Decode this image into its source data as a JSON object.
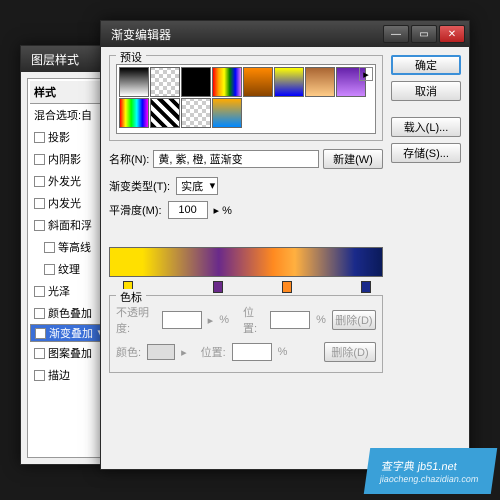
{
  "layerStyle": {
    "title": "图层样式",
    "panelHeader": "样式",
    "blendRow": "混合选项:自",
    "items": [
      {
        "label": "投影",
        "checked": false
      },
      {
        "label": "内阴影",
        "checked": false
      },
      {
        "label": "外发光",
        "checked": false
      },
      {
        "label": "内发光",
        "checked": false
      },
      {
        "label": "斜面和浮",
        "checked": false
      },
      {
        "label": "等高线",
        "checked": false,
        "indent": true
      },
      {
        "label": "纹理",
        "checked": false,
        "indent": true
      },
      {
        "label": "光泽",
        "checked": false
      },
      {
        "label": "颜色叠加",
        "checked": false
      },
      {
        "label": "渐变叠加",
        "checked": true,
        "selected": true
      },
      {
        "label": "图案叠加",
        "checked": false
      },
      {
        "label": "描边",
        "checked": false
      }
    ]
  },
  "gradEditor": {
    "title": "渐变编辑器",
    "presetsLabel": "预设",
    "arrowIcon": "▸",
    "buttons": {
      "ok": "确定",
      "cancel": "取消",
      "load": "载入(L)...",
      "save": "存储(S)...",
      "new": "新建(W)"
    },
    "nameLabel": "名称(N):",
    "nameValue": "黄, 紫, 橙, 蓝渐变",
    "typeLabel": "渐变类型(T):",
    "typeValue": "实底",
    "smoothLabel": "平滑度(M):",
    "smoothValue": "100",
    "smoothUnit": "%",
    "stopsTitle": "色标",
    "opacityLabel": "不透明度:",
    "locationLabel": "位置:",
    "colorLabel": "颜色:",
    "deleteLabel": "删除(D)",
    "percentUnit": "%",
    "swatches": [
      "linear-gradient(#000,#fff)",
      "repeating-conic-gradient(#ccc 0 25%,#fff 0 50%) 0/8px 8px",
      "linear-gradient(#000,#000)",
      "linear-gradient(90deg,red,orange,yellow,green,blue,violet)",
      "linear-gradient(#f80,#840)",
      "linear-gradient(#ff0,#00f)",
      "linear-gradient(#a63,#fc8)",
      "linear-gradient(#62a,#c8f)",
      "linear-gradient(90deg,#f00,#ff0,#0f0,#0ff,#00f,#f0f)",
      "repeating-linear-gradient(45deg,#000 0 4px,#fff 4px 8px)",
      "repeating-conic-gradient(#ccc 0 25%,#fff 0 50%) 0/8px 8px",
      "linear-gradient(#fa0,#08f)"
    ],
    "stopPositions": [
      5,
      38,
      63,
      92
    ],
    "stopColors": [
      "#ffe000",
      "#6a2a8a",
      "#ff8a20",
      "#1a2a8a"
    ]
  },
  "watermark": {
    "main": "查字典 jb51.net",
    "sub": "jiaocheng.chazidian.com"
  }
}
